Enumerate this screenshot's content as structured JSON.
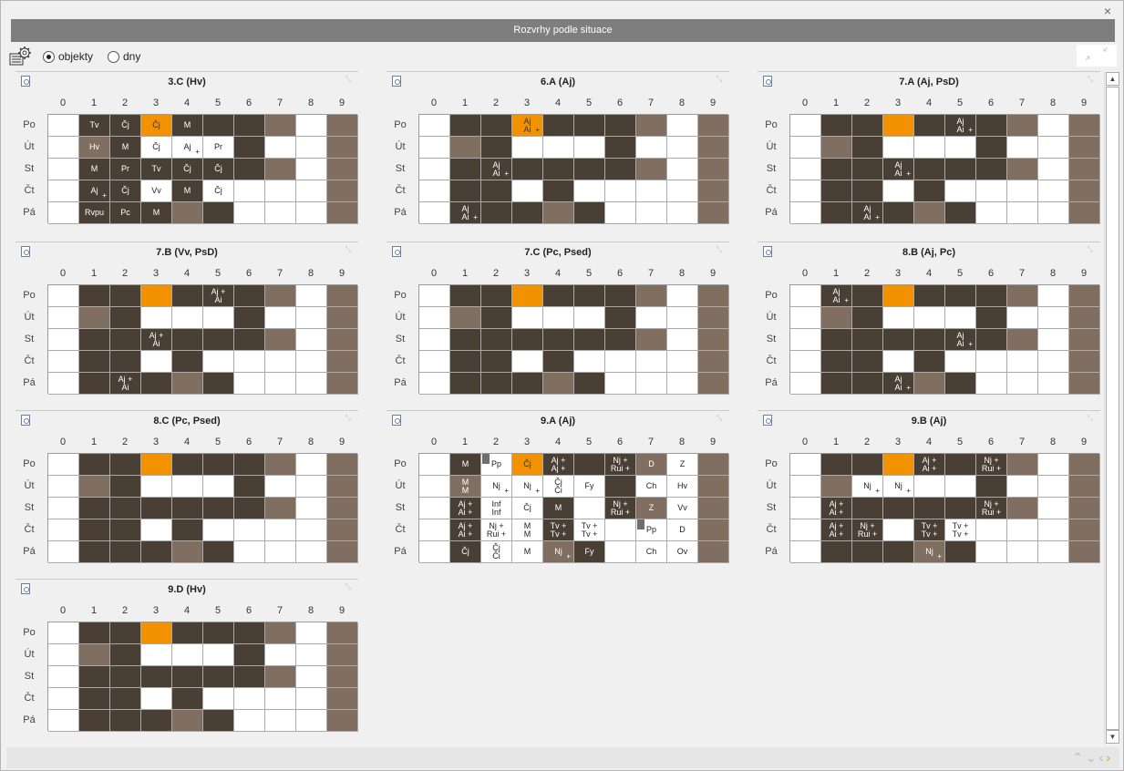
{
  "window": {
    "title": "Rozvrhy podle situace",
    "close_glyph": "×"
  },
  "toolbar": {
    "options": [
      {
        "label": "objekty",
        "selected": true
      },
      {
        "label": "dny",
        "selected": false
      }
    ]
  },
  "hours": [
    "0",
    "1",
    "2",
    "3",
    "4",
    "5",
    "6",
    "7",
    "8",
    "9"
  ],
  "days": [
    "Po",
    "Út",
    "St",
    "Čt",
    "Pá"
  ],
  "colors": {
    "busy": "#4a3f35",
    "blocked": "#806f60",
    "current": "#f39200",
    "free": "#ffffff"
  },
  "panels": [
    {
      "title": "3.C (Hv)",
      "grid": [
        "WDDODDDBWB",
        "WBDWWWDWWB",
        "WDDDDDDBWB",
        "WDDWDWWWWB",
        "WDDDBDWWWB"
      ],
      "labels": [
        {
          "d": 0,
          "h": 1,
          "t": "Tv"
        },
        {
          "d": 0,
          "h": 2,
          "t": "Čj"
        },
        {
          "d": 0,
          "h": 3,
          "t": "Čj"
        },
        {
          "d": 0,
          "h": 4,
          "t": "M"
        },
        {
          "d": 1,
          "h": 1,
          "t": "Hv"
        },
        {
          "d": 1,
          "h": 2,
          "t": "M"
        },
        {
          "d": 1,
          "h": 3,
          "t": "Čj"
        },
        {
          "d": 1,
          "h": 4,
          "t": "Aj",
          "p": true
        },
        {
          "d": 1,
          "h": 5,
          "t": "Pr"
        },
        {
          "d": 2,
          "h": 1,
          "t": "M"
        },
        {
          "d": 2,
          "h": 2,
          "t": "Pr"
        },
        {
          "d": 2,
          "h": 3,
          "t": "Tv"
        },
        {
          "d": 2,
          "h": 4,
          "t": "Čj"
        },
        {
          "d": 2,
          "h": 5,
          "t": "Čj"
        },
        {
          "d": 3,
          "h": 1,
          "t": "Aj",
          "p": true
        },
        {
          "d": 3,
          "h": 2,
          "t": "Čj"
        },
        {
          "d": 3,
          "h": 3,
          "t": "Vv"
        },
        {
          "d": 3,
          "h": 4,
          "t": "M"
        },
        {
          "d": 3,
          "h": 5,
          "t": "Čj"
        },
        {
          "d": 4,
          "h": 1,
          "t": "Rvpu"
        },
        {
          "d": 4,
          "h": 2,
          "t": "Pc"
        },
        {
          "d": 4,
          "h": 3,
          "t": "M"
        }
      ]
    },
    {
      "title": "6.A (Aj)",
      "grid": [
        "WDDODDDBWB",
        "WBDWWWDWWB",
        "WDDDDDDBWB",
        "WDDWDWWWWB",
        "WDDDBDWWWB"
      ],
      "labels": [
        {
          "d": 0,
          "h": 3,
          "t": "Aj",
          "b": "Ai",
          "p": true
        },
        {
          "d": 2,
          "h": 2,
          "t": "Aj",
          "b": "Ai",
          "p": true
        },
        {
          "d": 4,
          "h": 1,
          "t": "Aj",
          "b": "Ai",
          "p": true
        }
      ]
    },
    {
      "title": "7.A (Aj, PsD)",
      "grid": [
        "WDDODDDBWB",
        "WBDWWWDWWB",
        "WDDDDDDBWB",
        "WDDWDWWWWB",
        "WDDDBDWWWB"
      ],
      "labels": [
        {
          "d": 0,
          "h": 5,
          "t": "Aj",
          "b": "Ai",
          "p": true
        },
        {
          "d": 2,
          "h": 3,
          "t": "Aj",
          "b": "Ai",
          "p": true
        },
        {
          "d": 4,
          "h": 2,
          "t": "Aj",
          "b": "Ai",
          "p": true
        }
      ]
    },
    {
      "title": "7.B (Vv, PsD)",
      "grid": [
        "WDDODDDBWB",
        "WBDWWWDWWB",
        "WDDDDDDBWB",
        "WDDWDWWWWB",
        "WDDDBDWWWB"
      ],
      "labels": [
        {
          "d": 0,
          "h": 5,
          "t": "Aj +",
          "b": "Ai"
        },
        {
          "d": 2,
          "h": 3,
          "t": "Aj +",
          "b": "Ai"
        },
        {
          "d": 4,
          "h": 2,
          "t": "Aj +",
          "b": "Ai"
        }
      ]
    },
    {
      "title": "7.C (Pc, Psed)",
      "grid": [
        "WDDODDDBWB",
        "WBDWWWDWWB",
        "WDDDDDDBWB",
        "WDDWDWWWWB",
        "WDDDBDWWWB"
      ],
      "labels": []
    },
    {
      "title": "8.B (Aj, Pc)",
      "grid": [
        "WDDODDDBWB",
        "WBDWWWDWWB",
        "WDDDDDDBWB",
        "WDDWDWWWWB",
        "WDDDBDWWWB"
      ],
      "labels": [
        {
          "d": 0,
          "h": 1,
          "t": "Aj",
          "b": "Ai",
          "p": true
        },
        {
          "d": 2,
          "h": 5,
          "t": "Aj",
          "b": "Ai",
          "p": true
        },
        {
          "d": 4,
          "h": 3,
          "t": "Aj",
          "b": "Ai",
          "p": true
        }
      ]
    },
    {
      "title": "8.C (Pc, Psed)",
      "grid": [
        "WDDODDDBWB",
        "WBDWWWDWWB",
        "WDDDDDDBWB",
        "WDDWDWWWWB",
        "WDDDBDWWWB"
      ],
      "labels": []
    },
    {
      "title": "9.A (Aj)",
      "grid": [
        "WDWODDDBWB",
        "WBWWWWDWWB",
        "WDWWDWDBWB",
        "WDWWDWWWWB",
        "WDWWBDWWWB"
      ],
      "labels": [
        {
          "d": 0,
          "h": 1,
          "t": "M"
        },
        {
          "d": 0,
          "h": 2,
          "t": "Pp",
          "mk": true
        },
        {
          "d": 0,
          "h": 3,
          "t": "Čj"
        },
        {
          "d": 0,
          "h": 4,
          "t": "Aj +",
          "b": "Aj +"
        },
        {
          "d": 0,
          "h": 6,
          "t": "Nj +",
          "b": "Rui +"
        },
        {
          "d": 0,
          "h": 7,
          "t": "D"
        },
        {
          "d": 0,
          "h": 8,
          "t": "Z"
        },
        {
          "d": 1,
          "h": 1,
          "t": "M",
          "b": "M"
        },
        {
          "d": 1,
          "h": 2,
          "t": "Nj",
          "p": true
        },
        {
          "d": 1,
          "h": 3,
          "t": "Nj",
          "p": true
        },
        {
          "d": 1,
          "h": 4,
          "t": "Čj",
          "b": "Či"
        },
        {
          "d": 1,
          "h": 5,
          "t": "Fy"
        },
        {
          "d": 1,
          "h": 7,
          "t": "Ch"
        },
        {
          "d": 1,
          "h": 8,
          "t": "Hv"
        },
        {
          "d": 2,
          "h": 1,
          "t": "Aj +",
          "b": "Ai +"
        },
        {
          "d": 2,
          "h": 2,
          "t": "Inf",
          "b": "Inf"
        },
        {
          "d": 2,
          "h": 3,
          "t": "Čj"
        },
        {
          "d": 2,
          "h": 4,
          "t": "M"
        },
        {
          "d": 2,
          "h": 6,
          "t": "Nj +",
          "b": "Rui +"
        },
        {
          "d": 2,
          "h": 7,
          "t": "Z"
        },
        {
          "d": 2,
          "h": 8,
          "t": "Vv"
        },
        {
          "d": 3,
          "h": 1,
          "t": "Aj +",
          "b": "Ai +"
        },
        {
          "d": 3,
          "h": 2,
          "t": "Nj +",
          "b": "Rui +"
        },
        {
          "d": 3,
          "h": 3,
          "t": "M",
          "b": "M"
        },
        {
          "d": 3,
          "h": 4,
          "t": "Tv +",
          "b": "Tv +"
        },
        {
          "d": 3,
          "h": 5,
          "t": "Tv +",
          "b": "Tv +"
        },
        {
          "d": 3,
          "h": 7,
          "t": "Pp",
          "mk": true
        },
        {
          "d": 3,
          "h": 8,
          "t": "D"
        },
        {
          "d": 4,
          "h": 1,
          "t": "Čj"
        },
        {
          "d": 4,
          "h": 2,
          "t": "Čj",
          "b": "Či"
        },
        {
          "d": 4,
          "h": 3,
          "t": "M"
        },
        {
          "d": 4,
          "h": 4,
          "t": "Nj",
          "p": true
        },
        {
          "d": 4,
          "h": 5,
          "t": "Fy"
        },
        {
          "d": 4,
          "h": 7,
          "t": "Ch"
        },
        {
          "d": 4,
          "h": 8,
          "t": "Ov"
        }
      ]
    },
    {
      "title": "9.B (Aj)",
      "grid": [
        "WDDODDDBWB",
        "WBWWWWDWWB",
        "WDDDDDDBWB",
        "WDDWDWWWWB",
        "WDDDBDWWWB"
      ],
      "labels": [
        {
          "d": 0,
          "h": 4,
          "t": "Aj +",
          "b": "Ai +"
        },
        {
          "d": 0,
          "h": 6,
          "t": "Nj +",
          "b": "Rui +"
        },
        {
          "d": 1,
          "h": 2,
          "t": "Nj",
          "p": true
        },
        {
          "d": 1,
          "h": 3,
          "t": "Nj",
          "p": true
        },
        {
          "d": 2,
          "h": 1,
          "t": "Aj +",
          "b": "Ai +"
        },
        {
          "d": 2,
          "h": 6,
          "t": "Nj +",
          "b": "Rui +"
        },
        {
          "d": 3,
          "h": 1,
          "t": "Aj +",
          "b": "Ai +"
        },
        {
          "d": 3,
          "h": 2,
          "t": "Nj +",
          "b": "Rui +"
        },
        {
          "d": 3,
          "h": 4,
          "t": "Tv +",
          "b": "Tv +"
        },
        {
          "d": 3,
          "h": 5,
          "t": "Tv +",
          "b": "Tv +"
        },
        {
          "d": 4,
          "h": 4,
          "t": "Nj",
          "p": true
        }
      ]
    },
    {
      "title": "9.D (Hv)",
      "grid": [
        "WDDODDDBWB",
        "WBDWWWDWWB",
        "WDDDDDDBWB",
        "WDDWDWWWWB",
        "WDDDBDWWWB"
      ],
      "labels": []
    }
  ]
}
